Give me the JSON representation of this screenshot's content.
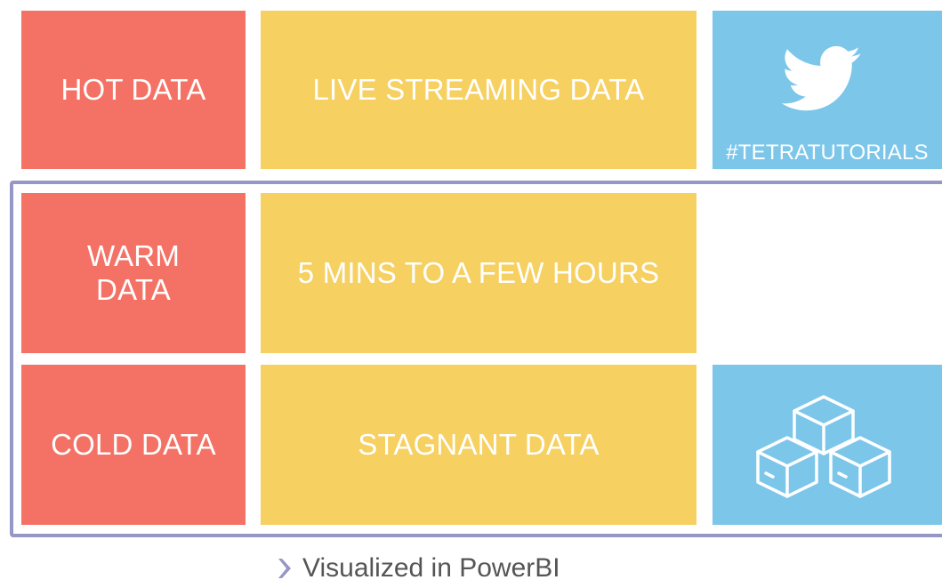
{
  "rows": {
    "hot": {
      "label": "HOT DATA",
      "description": "LIVE STREAMING DATA",
      "tag": "#TETRATUTORIALS",
      "icon": "twitter-bird-icon"
    },
    "warm": {
      "label_line1": "WARM",
      "label_line2": "DATA",
      "description": "5 MINS TO A FEW HOURS"
    },
    "cold": {
      "label": "COLD DATA",
      "description": "STAGNANT DATA",
      "icon": "storage-boxes-icon"
    }
  },
  "footer": {
    "caption": "Visualized in PowerBI",
    "icon": "chevron-right-icon"
  },
  "colors": {
    "red": "#f47265",
    "yellow": "#f6d060",
    "blue": "#7cc6ea",
    "frame": "#9597c4",
    "chevron": "#9597c4"
  }
}
